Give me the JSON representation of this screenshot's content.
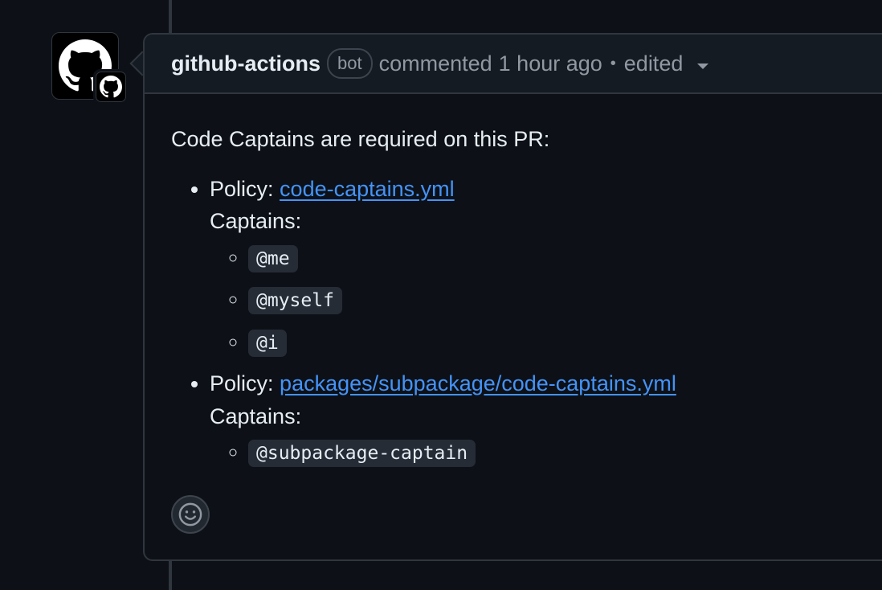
{
  "comment": {
    "author": "github-actions",
    "author_badge": "bot",
    "action": "commented",
    "time": "1 hour ago",
    "separator": "•",
    "edited_label": "edited",
    "body": {
      "intro": "Code Captains are required on this PR:",
      "policies": [
        {
          "policy_label": "Policy:",
          "file": "code-captains.yml",
          "captains_label": "Captains:",
          "captains": [
            "@me",
            "@myself",
            "@i"
          ]
        },
        {
          "policy_label": "Policy:",
          "file": "packages/subpackage/code-captains.yml",
          "captains_label": "Captains:",
          "captains": [
            "@subpackage-captain"
          ]
        }
      ]
    }
  },
  "icons": {
    "avatar": "github-mark-icon",
    "reaction": "smiley-icon",
    "edited_menu": "caret-down-icon"
  },
  "colors": {
    "background": "#0d1117",
    "header_bg": "#151b23",
    "border": "#30363d",
    "link": "#4493f8",
    "code_bg": "#262c36"
  }
}
